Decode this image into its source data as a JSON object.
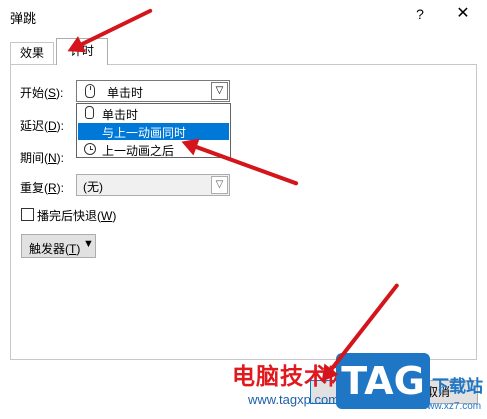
{
  "window": {
    "title": "弹跳",
    "help_label": "?",
    "close_label": "✕"
  },
  "tabs": [
    {
      "label": "效果",
      "active": false
    },
    {
      "label": "计时",
      "active": true
    }
  ],
  "timing": {
    "start": {
      "label_pre": "开始(",
      "accel": "S",
      "label_post": "):",
      "value": "单击时"
    },
    "delay": {
      "label_pre": "延迟(",
      "accel": "D",
      "label_post": "):"
    },
    "duration": {
      "label_pre": "期间(",
      "accel": "N",
      "label_post": "):"
    },
    "repeat": {
      "label_pre": "重复(",
      "accel": "R",
      "label_post": "):",
      "value": "(无)"
    },
    "rewind": {
      "label_pre": "播完后快退(",
      "accel": "W",
      "label_post": ")",
      "checked": false
    },
    "trigger_button": {
      "label_pre": "触发器(",
      "accel": "T",
      "label_post": ")",
      "arrow": "▼"
    }
  },
  "start_dropdown": {
    "options": [
      {
        "label": "单击时",
        "icon": "mouse-icon",
        "selected": false
      },
      {
        "label": "与上一动画同时",
        "icon": "none",
        "selected": true
      },
      {
        "label": "上一动画之后",
        "icon": "clock-icon",
        "selected": false
      }
    ]
  },
  "footer": {
    "ok_label": "确定",
    "cancel_label": "取消"
  },
  "watermark": {
    "site_name": "电脑技术网",
    "site_url": "www.tagxp.com",
    "logo_text": "TAG",
    "right_text": "下载站",
    "right_url": "www.xz7.com"
  },
  "colors": {
    "selection": "#0078d7",
    "annotation_arrow": "#d4161c",
    "watermark_red": "#e0191f",
    "watermark_blue": "#1e76c4"
  }
}
